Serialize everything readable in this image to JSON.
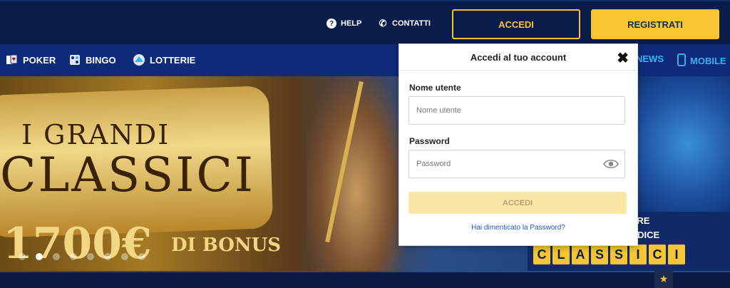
{
  "header": {
    "help_label": "HELP",
    "contact_label": "CONTATTI",
    "login_button": "ACCEDI",
    "register_button": "REGISTRATI"
  },
  "nav": {
    "items": [
      {
        "label": "POKER",
        "icon": "poker-cards-icon"
      },
      {
        "label": "BINGO",
        "icon": "bingo-icon"
      },
      {
        "label": "LOTTERIE",
        "icon": "lottery-icon"
      }
    ],
    "right_items": [
      {
        "label": "NEWS"
      },
      {
        "label": "MOBILE",
        "icon": "mobile-icon"
      }
    ]
  },
  "hero": {
    "title_line1": "I GRANDI",
    "title_line2": "CLASSICI",
    "amount": "1700€",
    "bonus_label": "DI BONUS",
    "promo_line1": "ARE",
    "promo_line2": "ODICE",
    "code_letters": [
      "C",
      "L",
      "A",
      "S",
      "S",
      "I",
      "C",
      "I"
    ],
    "slides": [
      false,
      true,
      false,
      false,
      false,
      false,
      false,
      false
    ]
  },
  "login_popup": {
    "title": "Accedi al tuo account",
    "username_label": "Nome utente",
    "username_placeholder": "Nome utente",
    "password_label": "Password",
    "password_placeholder": "Password",
    "submit_label": "ACCEDI",
    "forgot_link": "Hai dimenticato la Password?"
  },
  "colors": {
    "brand_yellow": "#f7c531",
    "header_bg": "#0a1d4a",
    "nav_bg": "#0f2a78",
    "link_blue": "#1e56b5",
    "nav_accent": "#36b2f2"
  }
}
